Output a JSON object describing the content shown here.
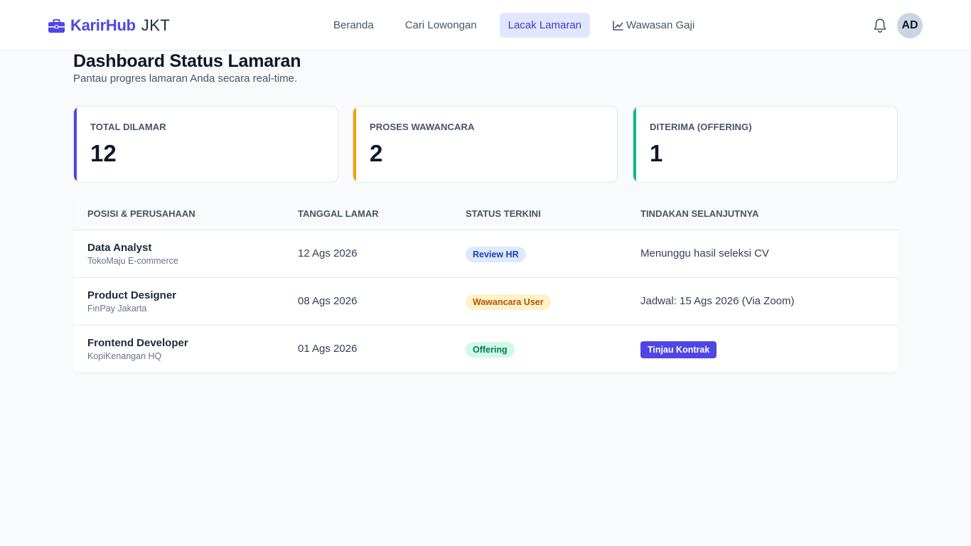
{
  "brand": {
    "name": "KarirHub",
    "suffix": "JKT",
    "icon": "briefcase-icon",
    "color": "#4f46e5"
  },
  "nav": {
    "items": [
      {
        "label": "Beranda",
        "active": false
      },
      {
        "label": "Cari Lowongan",
        "active": false
      },
      {
        "label": "Lacak Lamaran",
        "active": true
      },
      {
        "label": "Wawasan Gaji",
        "active": false,
        "icon": "chart-line-icon"
      }
    ]
  },
  "header": {
    "notification_icon": "bell-icon",
    "avatar_initials": "AD"
  },
  "page": {
    "title": "Dashboard Status Lamaran",
    "subtitle": "Pantau progres lamaran Anda secara real-time."
  },
  "stats": [
    {
      "label": "TOTAL DILAMAR",
      "value": "12",
      "accent": "#4f46e5"
    },
    {
      "label": "PROSES WAWANCARA",
      "value": "2",
      "accent": "#f59e0b"
    },
    {
      "label": "DITERIMA (OFFERING)",
      "value": "1",
      "accent": "#10b981"
    }
  ],
  "table": {
    "columns": [
      "POSISI & PERUSAHAAN",
      "TANGGAL LAMAR",
      "STATUS TERKINI",
      "TINDAKAN SELANJUTNYA"
    ],
    "rows": [
      {
        "position": "Data Analyst",
        "company": "TokoMaju E-commerce",
        "date": "12 Ags 2026",
        "status": "Review HR",
        "status_bg": "#dbeafe",
        "status_color": "#1e40af",
        "action": "Menunggu hasil seleksi CV"
      },
      {
        "position": "Product Designer",
        "company": "FinPay Jakarta",
        "date": "08 Ags 2026",
        "status": "Wawancara User",
        "status_bg": "#fef3c7",
        "status_color": "#b45309",
        "action": "Jadwal: 15 Ags 2026 (Via Zoom)"
      },
      {
        "position": "Frontend Developer",
        "company": "KopiKenangan HQ",
        "date": "01 Ags 2026",
        "status": "Offering",
        "status_bg": "#d1fae5",
        "status_color": "#047857",
        "action_button": "Tinjau Kontrak"
      }
    ]
  }
}
